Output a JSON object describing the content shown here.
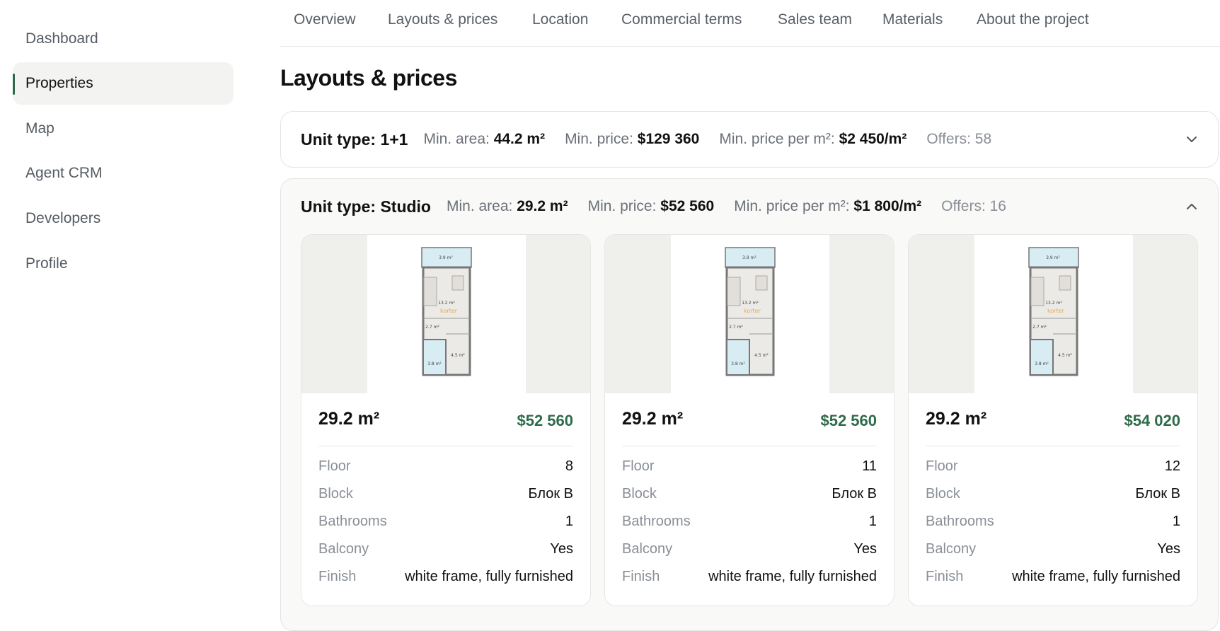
{
  "sidebar": {
    "items": [
      {
        "label": "Dashboard",
        "active": false
      },
      {
        "label": "Properties",
        "active": true
      },
      {
        "label": "Map",
        "active": false
      },
      {
        "label": "Agent CRM",
        "active": false
      },
      {
        "label": "Developers",
        "active": false
      },
      {
        "label": "Profile",
        "active": false
      }
    ]
  },
  "tabs": [
    "Overview",
    "Layouts & prices",
    "Location",
    "Commercial terms",
    "Sales team",
    "Materials",
    "About the project"
  ],
  "page_title": "Layouts & prices",
  "unit_types": [
    {
      "title": "Unit type: 1+1",
      "min_area_label": "Min. area:",
      "min_area": "44.2 m²",
      "min_price_label": "Min. price:",
      "min_price": "$129 360",
      "min_ppm_label": "Min. price per m²:",
      "min_ppm": "$2 450/m²",
      "offers": "Offers: 58",
      "state": "collapsed",
      "chevron_icon": "chevron-down-icon"
    },
    {
      "title": "Unit type: Studio",
      "min_area_label": "Min. area:",
      "min_area": "29.2 m²",
      "min_price_label": "Min. price:",
      "min_price": "$52 560",
      "min_ppm_label": "Min. price per m²:",
      "min_ppm": "$1 800/m²",
      "offers": "Offers: 16",
      "state": "expanded",
      "chevron_icon": "chevron-up-icon"
    }
  ],
  "detail_labels": {
    "floor": "Floor",
    "block": "Block",
    "bathrooms": "Bathrooms",
    "balcony": "Balcony",
    "finish": "Finish"
  },
  "plan_labels": {
    "balcony": "3.9 m²",
    "living": "13.2 m²",
    "watermark": "korter",
    "hall": "2.7 m²",
    "bath": "3.8 m²",
    "entry": "4.5 m²"
  },
  "cards": [
    {
      "area": "29.2 m²",
      "price": "$52 560",
      "floor": "8",
      "block": "Блок B",
      "bathrooms": "1",
      "balcony": "Yes",
      "finish": "white frame, fully furnished"
    },
    {
      "area": "29.2 m²",
      "price": "$52 560",
      "floor": "11",
      "block": "Блок B",
      "bathrooms": "1",
      "balcony": "Yes",
      "finish": "white frame, fully furnished"
    },
    {
      "area": "29.2 m²",
      "price": "$54 020",
      "floor": "12",
      "block": "Блок B",
      "bathrooms": "1",
      "balcony": "Yes",
      "finish": "white frame, fully furnished"
    }
  ],
  "colors": {
    "accent": "#2f6b4a",
    "active_bg": "#f3f3f1"
  }
}
